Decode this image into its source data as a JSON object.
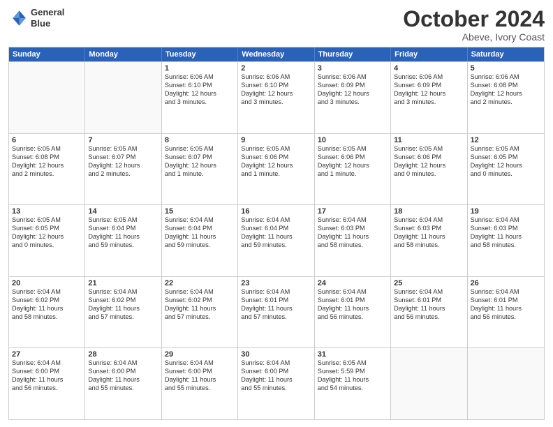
{
  "header": {
    "logo_line1": "General",
    "logo_line2": "Blue",
    "month": "October 2024",
    "location": "Abeve, Ivory Coast"
  },
  "weekdays": [
    "Sunday",
    "Monday",
    "Tuesday",
    "Wednesday",
    "Thursday",
    "Friday",
    "Saturday"
  ],
  "weeks": [
    [
      {
        "day": "",
        "lines": [],
        "empty": true
      },
      {
        "day": "",
        "lines": [],
        "empty": true
      },
      {
        "day": "1",
        "lines": [
          "Sunrise: 6:06 AM",
          "Sunset: 6:10 PM",
          "Daylight: 12 hours",
          "and 3 minutes."
        ],
        "empty": false
      },
      {
        "day": "2",
        "lines": [
          "Sunrise: 6:06 AM",
          "Sunset: 6:10 PM",
          "Daylight: 12 hours",
          "and 3 minutes."
        ],
        "empty": false
      },
      {
        "day": "3",
        "lines": [
          "Sunrise: 6:06 AM",
          "Sunset: 6:09 PM",
          "Daylight: 12 hours",
          "and 3 minutes."
        ],
        "empty": false
      },
      {
        "day": "4",
        "lines": [
          "Sunrise: 6:06 AM",
          "Sunset: 6:09 PM",
          "Daylight: 12 hours",
          "and 3 minutes."
        ],
        "empty": false
      },
      {
        "day": "5",
        "lines": [
          "Sunrise: 6:06 AM",
          "Sunset: 6:08 PM",
          "Daylight: 12 hours",
          "and 2 minutes."
        ],
        "empty": false
      }
    ],
    [
      {
        "day": "6",
        "lines": [
          "Sunrise: 6:05 AM",
          "Sunset: 6:08 PM",
          "Daylight: 12 hours",
          "and 2 minutes."
        ],
        "empty": false
      },
      {
        "day": "7",
        "lines": [
          "Sunrise: 6:05 AM",
          "Sunset: 6:07 PM",
          "Daylight: 12 hours",
          "and 2 minutes."
        ],
        "empty": false
      },
      {
        "day": "8",
        "lines": [
          "Sunrise: 6:05 AM",
          "Sunset: 6:07 PM",
          "Daylight: 12 hours",
          "and 1 minute."
        ],
        "empty": false
      },
      {
        "day": "9",
        "lines": [
          "Sunrise: 6:05 AM",
          "Sunset: 6:06 PM",
          "Daylight: 12 hours",
          "and 1 minute."
        ],
        "empty": false
      },
      {
        "day": "10",
        "lines": [
          "Sunrise: 6:05 AM",
          "Sunset: 6:06 PM",
          "Daylight: 12 hours",
          "and 1 minute."
        ],
        "empty": false
      },
      {
        "day": "11",
        "lines": [
          "Sunrise: 6:05 AM",
          "Sunset: 6:06 PM",
          "Daylight: 12 hours",
          "and 0 minutes."
        ],
        "empty": false
      },
      {
        "day": "12",
        "lines": [
          "Sunrise: 6:05 AM",
          "Sunset: 6:05 PM",
          "Daylight: 12 hours",
          "and 0 minutes."
        ],
        "empty": false
      }
    ],
    [
      {
        "day": "13",
        "lines": [
          "Sunrise: 6:05 AM",
          "Sunset: 6:05 PM",
          "Daylight: 12 hours",
          "and 0 minutes."
        ],
        "empty": false
      },
      {
        "day": "14",
        "lines": [
          "Sunrise: 6:05 AM",
          "Sunset: 6:04 PM",
          "Daylight: 11 hours",
          "and 59 minutes."
        ],
        "empty": false
      },
      {
        "day": "15",
        "lines": [
          "Sunrise: 6:04 AM",
          "Sunset: 6:04 PM",
          "Daylight: 11 hours",
          "and 59 minutes."
        ],
        "empty": false
      },
      {
        "day": "16",
        "lines": [
          "Sunrise: 6:04 AM",
          "Sunset: 6:04 PM",
          "Daylight: 11 hours",
          "and 59 minutes."
        ],
        "empty": false
      },
      {
        "day": "17",
        "lines": [
          "Sunrise: 6:04 AM",
          "Sunset: 6:03 PM",
          "Daylight: 11 hours",
          "and 58 minutes."
        ],
        "empty": false
      },
      {
        "day": "18",
        "lines": [
          "Sunrise: 6:04 AM",
          "Sunset: 6:03 PM",
          "Daylight: 11 hours",
          "and 58 minutes."
        ],
        "empty": false
      },
      {
        "day": "19",
        "lines": [
          "Sunrise: 6:04 AM",
          "Sunset: 6:03 PM",
          "Daylight: 11 hours",
          "and 58 minutes."
        ],
        "empty": false
      }
    ],
    [
      {
        "day": "20",
        "lines": [
          "Sunrise: 6:04 AM",
          "Sunset: 6:02 PM",
          "Daylight: 11 hours",
          "and 58 minutes."
        ],
        "empty": false
      },
      {
        "day": "21",
        "lines": [
          "Sunrise: 6:04 AM",
          "Sunset: 6:02 PM",
          "Daylight: 11 hours",
          "and 57 minutes."
        ],
        "empty": false
      },
      {
        "day": "22",
        "lines": [
          "Sunrise: 6:04 AM",
          "Sunset: 6:02 PM",
          "Daylight: 11 hours",
          "and 57 minutes."
        ],
        "empty": false
      },
      {
        "day": "23",
        "lines": [
          "Sunrise: 6:04 AM",
          "Sunset: 6:01 PM",
          "Daylight: 11 hours",
          "and 57 minutes."
        ],
        "empty": false
      },
      {
        "day": "24",
        "lines": [
          "Sunrise: 6:04 AM",
          "Sunset: 6:01 PM",
          "Daylight: 11 hours",
          "and 56 minutes."
        ],
        "empty": false
      },
      {
        "day": "25",
        "lines": [
          "Sunrise: 6:04 AM",
          "Sunset: 6:01 PM",
          "Daylight: 11 hours",
          "and 56 minutes."
        ],
        "empty": false
      },
      {
        "day": "26",
        "lines": [
          "Sunrise: 6:04 AM",
          "Sunset: 6:01 PM",
          "Daylight: 11 hours",
          "and 56 minutes."
        ],
        "empty": false
      }
    ],
    [
      {
        "day": "27",
        "lines": [
          "Sunrise: 6:04 AM",
          "Sunset: 6:00 PM",
          "Daylight: 11 hours",
          "and 56 minutes."
        ],
        "empty": false
      },
      {
        "day": "28",
        "lines": [
          "Sunrise: 6:04 AM",
          "Sunset: 6:00 PM",
          "Daylight: 11 hours",
          "and 55 minutes."
        ],
        "empty": false
      },
      {
        "day": "29",
        "lines": [
          "Sunrise: 6:04 AM",
          "Sunset: 6:00 PM",
          "Daylight: 11 hours",
          "and 55 minutes."
        ],
        "empty": false
      },
      {
        "day": "30",
        "lines": [
          "Sunrise: 6:04 AM",
          "Sunset: 6:00 PM",
          "Daylight: 11 hours",
          "and 55 minutes."
        ],
        "empty": false
      },
      {
        "day": "31",
        "lines": [
          "Sunrise: 6:05 AM",
          "Sunset: 5:59 PM",
          "Daylight: 11 hours",
          "and 54 minutes."
        ],
        "empty": false
      },
      {
        "day": "",
        "lines": [],
        "empty": true
      },
      {
        "day": "",
        "lines": [],
        "empty": true
      }
    ]
  ]
}
